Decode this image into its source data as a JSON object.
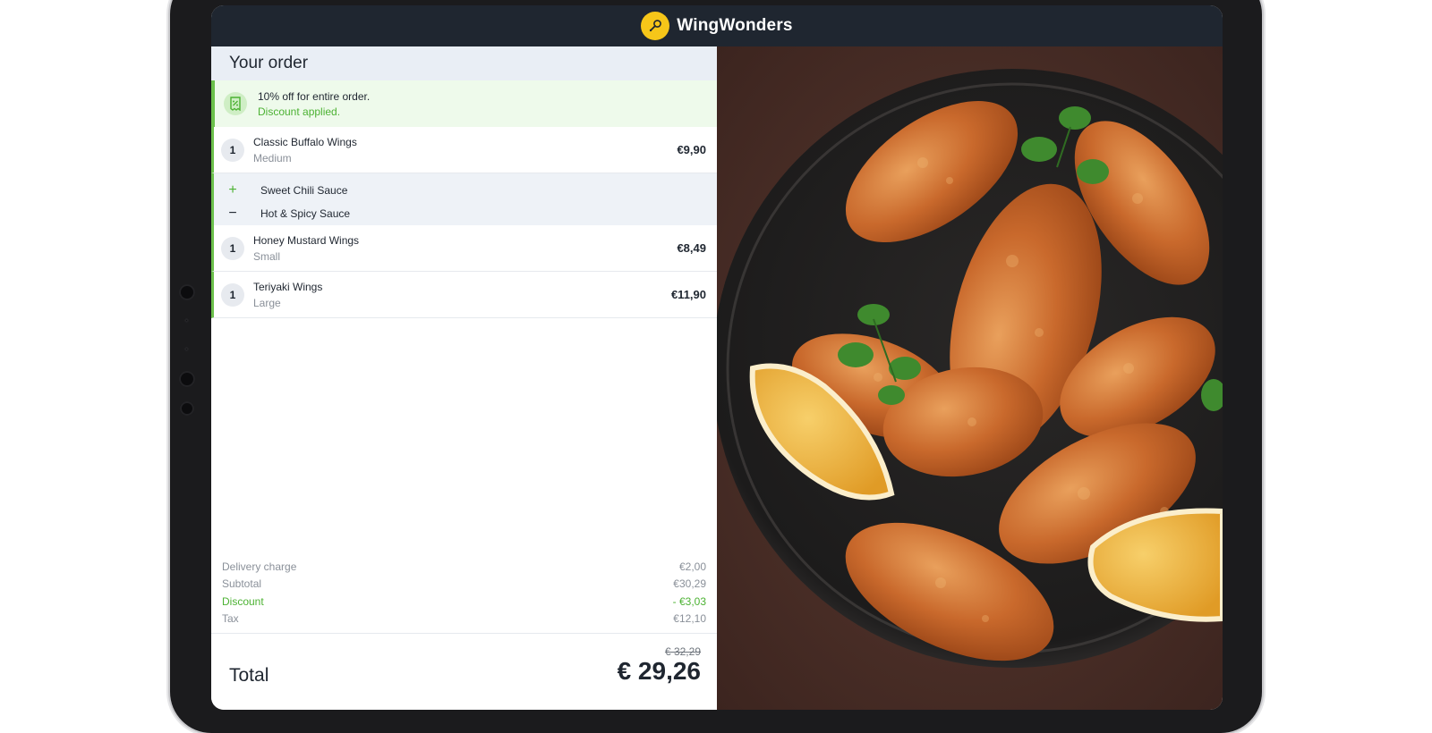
{
  "brand": {
    "name": "WingWonders",
    "logo": "chicken-leg-icon",
    "accent": "#f6c619"
  },
  "order": {
    "title": "Your order",
    "discount": {
      "line1": "10% off for entire order.",
      "line2": "Discount applied.",
      "icon": "receipt-icon"
    },
    "items": [
      {
        "qty": "1",
        "name": "Classic Buffalo Wings",
        "size": "Medium",
        "price": "€9,90"
      },
      {
        "qty": "1",
        "name": "Honey Mustard Wings",
        "size": "Small",
        "price": "€8,49"
      },
      {
        "qty": "1",
        "name": "Teriyaki Wings",
        "size": "Large",
        "price": "€11,90"
      }
    ],
    "modifiers": [
      {
        "sign": "+",
        "label": "Sweet Chili Sauce"
      },
      {
        "sign": "−",
        "label": "Hot & Spicy Sauce"
      }
    ]
  },
  "summary": {
    "delivery": {
      "label": "Delivery charge",
      "value": "€2,00"
    },
    "subtotal": {
      "label": "Subtotal",
      "value": "€30,29"
    },
    "discount": {
      "label": "Discount",
      "value": "- €3,03"
    },
    "tax": {
      "label": "Tax",
      "value": "€12,10"
    }
  },
  "total": {
    "label": "Total",
    "old": "€ 32,29",
    "value": "€ 29,26"
  },
  "colors": {
    "green": "#4cb233",
    "dark": "#1f2630",
    "panel": "#e9eef5"
  }
}
